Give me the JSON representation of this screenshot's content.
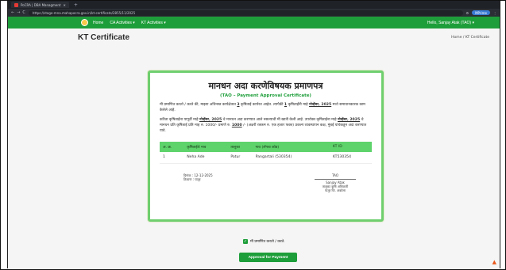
{
  "browser": {
    "tab_title": "PoCRA | DBA Managment",
    "new_tab": "+",
    "back": "←",
    "forward": "→",
    "reload": "C",
    "url": "https://stage-mna.mahapocra.gov.in/kt-certificate/2855/11/2025",
    "profile_label": "MPrime"
  },
  "nav": {
    "home": "Home",
    "ca_activities": "CA Activities ▾",
    "kt_activities": "KT Activities ▾",
    "user": "Hello, Sanjay Atak (TAO) ▾"
  },
  "page": {
    "title": "KT Certificate",
    "breadcrumb": "Home / KT Certificate"
  },
  "certificate": {
    "heading": "मानधन अदा करणेविषयक प्रमाणपत्र",
    "subheading": "(TAO – Payment Approval Certificate)",
    "para1_a": "मी प्रमाणित करतो / करते की, माझ्या अधिनस्त कार्यक्षेत्रात",
    "para1_count": "3",
    "para1_b": "कृषिताई कार्यरत आहेत. त्यापैकी",
    "para1_count2": "1",
    "para1_c": "कृषिताईंनी माहे",
    "para1_month": "नोव्हेंबर, 2025",
    "para1_d": "मध्ये समाधानकारक काम केलेले आहे.",
    "para2_a": "करिता कृषिताईंना यापूर्वी माहे",
    "para2_month": "नोव्हेंबर, 2025",
    "para2_b": "चे मानधन अदा करण्यात आले नसल्याची मी खात्री केली आहे. उपरोक्त कृषिताईंना माहे",
    "para2_month2": "नोव्हेंबर, 2025",
    "para2_c": "चे मानधन प्रति कृषिताई प्रति माह रु. 1000/- प्रमाणे रु.",
    "para2_amount": "1000",
    "para2_d": "/- (अक्षरी रक्कम रु. एक हजार फक्त) प्रकल्प व्यवस्थापन कक्ष, मुंबई यांचेकडून अदा करण्यात यावे.",
    "table": {
      "headers": [
        "अ. क्र.",
        "कृषिताईचे नाव",
        "तालुका",
        "गाव (लॅगाव कोड)",
        "KT ID"
      ],
      "rows": [
        [
          "1",
          "Neha Ade",
          "Patur",
          "Pangartali (530354)",
          "KT530354"
        ]
      ]
    },
    "date_label": "दिनांक : 12-12-2025",
    "place_label": "ठिकाण : पातूर",
    "sign_tao": "TAO",
    "sign_name": "Sanjay Atak",
    "sign_designation": "तालुका कृषि अधिकारी",
    "sign_office": "पातूर जि. अकोला"
  },
  "confirm_label": "मी प्रमाणित करतो / करते.",
  "approve_button": "Approval for Payment",
  "colors": {
    "brand_green": "#1e9e3a",
    "table_header": "#5ed36b",
    "accent_orange": "#e8571b"
  }
}
